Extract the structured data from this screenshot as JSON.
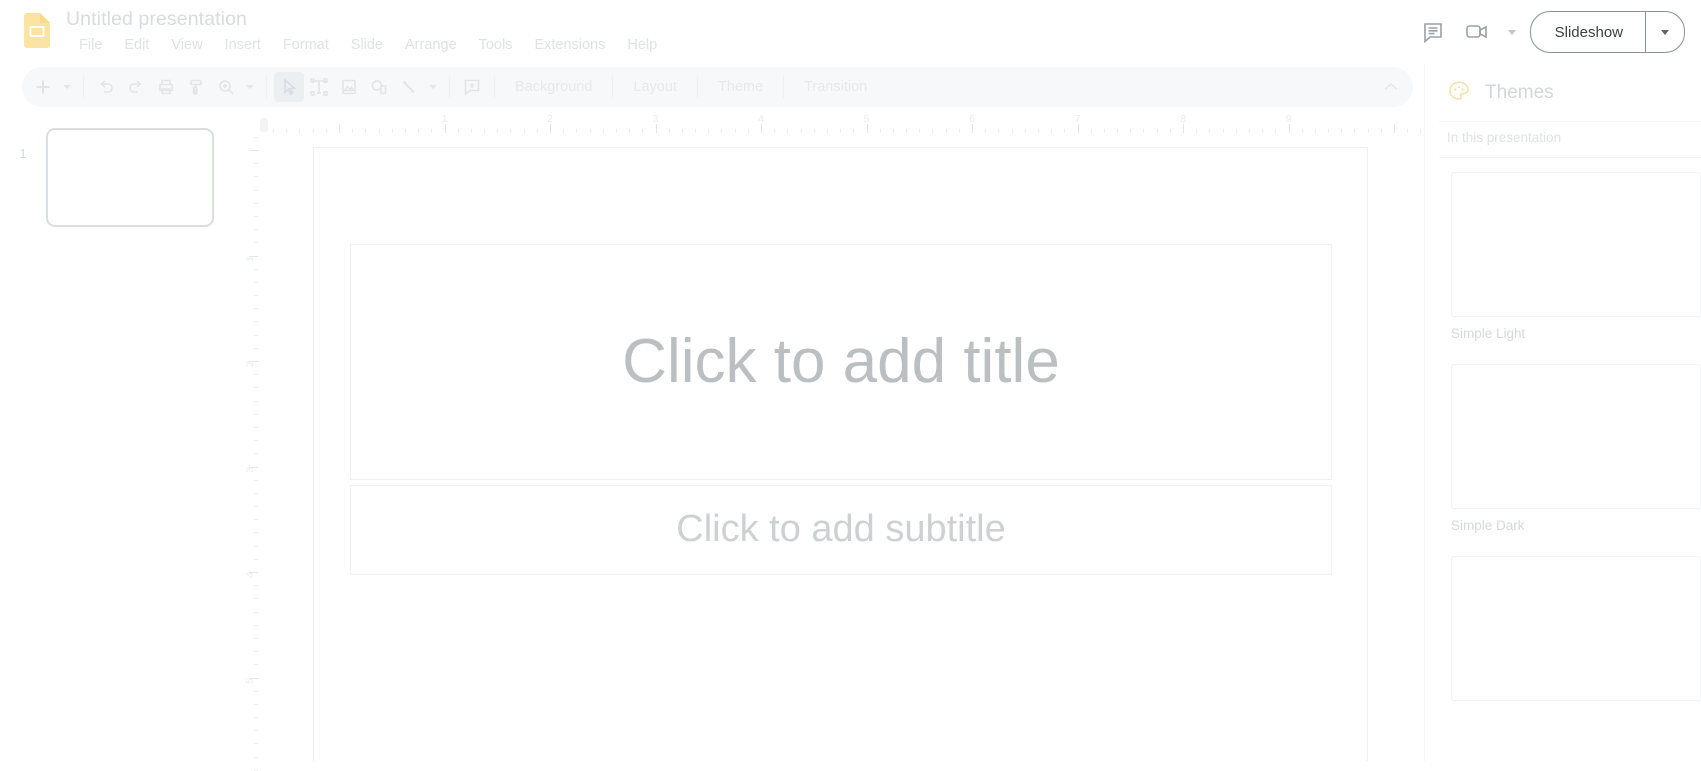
{
  "app": {
    "name": "Google Slides",
    "logo_icon": "slides-logo-icon",
    "logo_color": "#fbe2a0"
  },
  "header": {
    "doc_title": "Untitled presentation",
    "menus": [
      {
        "label": "File",
        "name": "menu-file"
      },
      {
        "label": "Edit",
        "name": "menu-edit"
      },
      {
        "label": "View",
        "name": "menu-view"
      },
      {
        "label": "Insert",
        "name": "menu-insert"
      },
      {
        "label": "Format",
        "name": "menu-format"
      },
      {
        "label": "Slide",
        "name": "menu-slide"
      },
      {
        "label": "Arrange",
        "name": "menu-arrange"
      },
      {
        "label": "Tools",
        "name": "menu-tools"
      },
      {
        "label": "Extensions",
        "name": "menu-extensions"
      },
      {
        "label": "Help",
        "name": "menu-help"
      }
    ],
    "comment_icon": "comment-history-icon",
    "meet_icon": "video-camera-icon",
    "meet_caret_icon": "chevron-down-icon",
    "slideshow_label": "Slideshow",
    "slideshow_caret_icon": "chevron-down-icon"
  },
  "toolbar": {
    "buttons": [
      {
        "name": "new-slide-button",
        "icon": "plus-icon"
      },
      {
        "name": "new-slide-caret",
        "icon": "chevron-down-icon"
      },
      {
        "name": "undo-button",
        "icon": "undo-arrow-icon"
      },
      {
        "name": "redo-button",
        "icon": "redo-arrow-icon"
      },
      {
        "name": "print-button",
        "icon": "printer-icon"
      },
      {
        "name": "paint-format-button",
        "icon": "paint-roller-icon"
      },
      {
        "name": "zoom-button",
        "icon": "magnifier-icon"
      },
      {
        "name": "zoom-caret",
        "icon": "chevron-down-icon"
      },
      {
        "name": "select-tool-button",
        "icon": "cursor-arrow-icon"
      },
      {
        "name": "text-box-button",
        "icon": "text-box-icon"
      },
      {
        "name": "insert-image-button",
        "icon": "image-icon"
      },
      {
        "name": "shape-button",
        "icon": "shape-icon"
      },
      {
        "name": "line-button",
        "icon": "line-icon"
      },
      {
        "name": "line-caret",
        "icon": "chevron-down-icon"
      },
      {
        "name": "add-comment-button",
        "icon": "comment-plus-icon"
      }
    ],
    "text_buttons": [
      {
        "label": "Background",
        "name": "background-button"
      },
      {
        "label": "Layout",
        "name": "layout-button"
      },
      {
        "label": "Theme",
        "name": "theme-button"
      },
      {
        "label": "Transition",
        "name": "transition-button"
      }
    ],
    "collapse_icon": "chevron-up-icon"
  },
  "filmstrip": {
    "slides": [
      {
        "number": "1",
        "name": "slide-thumbnail-1",
        "selected": true
      }
    ]
  },
  "rulers": {
    "horizontal_labels": [
      "1",
      "2",
      "3",
      "4",
      "5",
      "6",
      "7",
      "8",
      "9"
    ],
    "vertical_labels": [
      "1",
      "2",
      "3",
      "4",
      "5"
    ],
    "unit": "inches"
  },
  "canvas": {
    "title_placeholder": "Click to add title",
    "subtitle_placeholder": "Click to add subtitle"
  },
  "themes": {
    "panel_title": "Themes",
    "palette_icon": "palette-icon",
    "section_label": "In this presentation",
    "items": [
      {
        "label": "Simple Light",
        "name": "theme-simple-light"
      },
      {
        "label": "Simple Dark",
        "name": "theme-simple-dark"
      },
      {
        "label": "",
        "name": "theme-third"
      }
    ]
  }
}
